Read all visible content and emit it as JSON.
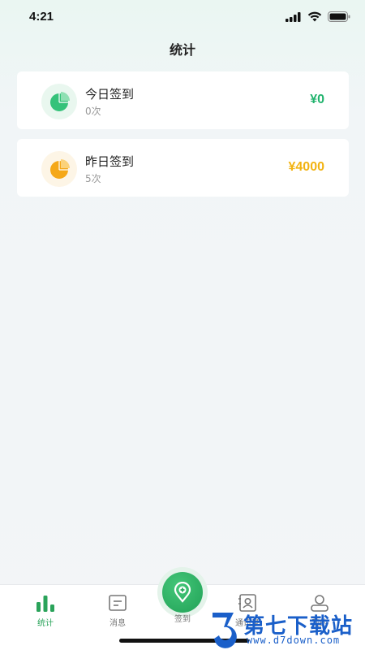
{
  "status_bar": {
    "time": "4:21",
    "icons": [
      "signal-icon",
      "wifi-icon",
      "battery-icon"
    ]
  },
  "page": {
    "title": "统计"
  },
  "cards": [
    {
      "title": "今日签到",
      "count": "0次",
      "amount": "¥0",
      "amount_color": "#21b36d",
      "icon": "pie-chart-icon",
      "icon_color": "#35c27a"
    },
    {
      "title": "昨日签到",
      "count": "5次",
      "amount": "¥4000",
      "amount_color": "#f2b312",
      "icon": "pie-chart-icon",
      "icon_color": "#f5a818"
    }
  ],
  "tabbar": {
    "items": [
      {
        "label": "统计",
        "icon": "bar-chart-icon",
        "active": true
      },
      {
        "label": "消息",
        "icon": "message-icon",
        "active": false
      },
      {
        "label": "签到",
        "icon": "location-plus-icon",
        "active": false
      },
      {
        "label": "通讯录",
        "icon": "contacts-icon",
        "active": false
      },
      {
        "label": "我的",
        "icon": "user-icon",
        "active": false
      }
    ],
    "accent_color": "#2aa35a"
  },
  "watermark": {
    "text": "第七下载站",
    "url": "www.d7down.com",
    "logo": "d7-logo"
  }
}
